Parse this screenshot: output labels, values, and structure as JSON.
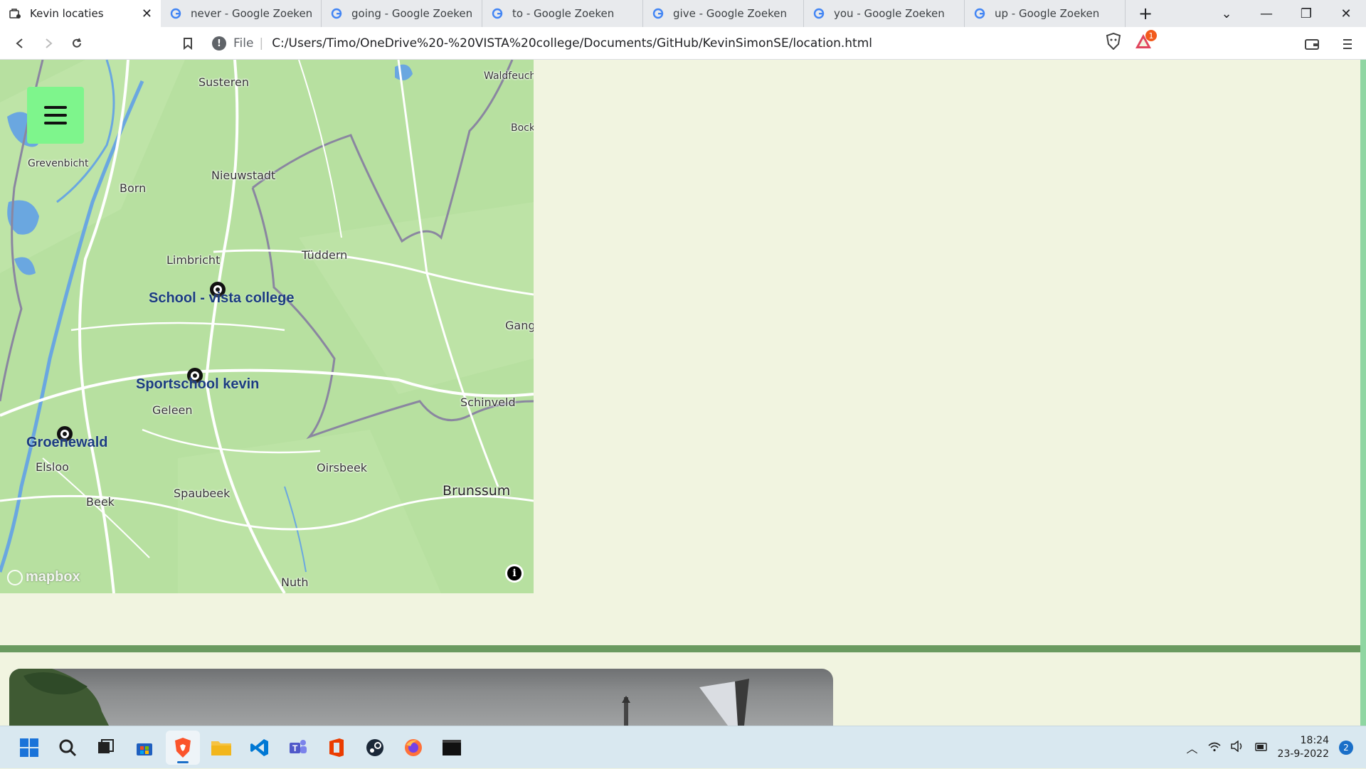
{
  "browser": {
    "tabs": [
      {
        "label": "Kevin locaties",
        "active": true
      },
      {
        "label": "never - Google Zoeken",
        "active": false
      },
      {
        "label": "going - Google Zoeken",
        "active": false
      },
      {
        "label": "to - Google Zoeken",
        "active": false
      },
      {
        "label": "give - Google Zoeken",
        "active": false
      },
      {
        "label": "you - Google Zoeken",
        "active": false
      },
      {
        "label": "up - Google Zoeken",
        "active": false
      }
    ],
    "address": {
      "scheme": "File",
      "url": "C:/Users/Timo/OneDrive%20-%20VISTA%20college/Documents/GitHub/KevinSimonSE/location.html"
    },
    "brave_badge_count": "1"
  },
  "map": {
    "places": [
      {
        "name": "Susteren"
      },
      {
        "name": "Waldfeucht"
      },
      {
        "name": "Bock"
      },
      {
        "name": "Grevenbicht"
      },
      {
        "name": "Born"
      },
      {
        "name": "Nieuwstadt"
      },
      {
        "name": "Limbricht"
      },
      {
        "name": "Tüddern"
      },
      {
        "name": "Gang"
      },
      {
        "name": "Geleen"
      },
      {
        "name": "Schinveld"
      },
      {
        "name": "Elsloo"
      },
      {
        "name": "Oirsbeek"
      },
      {
        "name": "Brunssum"
      },
      {
        "name": "Beek"
      },
      {
        "name": "Spaubeek"
      },
      {
        "name": "Nuth"
      }
    ],
    "markers": [
      {
        "label": "School - vista college"
      },
      {
        "label": "Sportschool kevin"
      },
      {
        "label": "Groenewald"
      }
    ],
    "logo": "mapbox",
    "attribution_symbol": "i"
  },
  "menu": {
    "icon": "hamburger-icon"
  },
  "taskbar": {
    "apps": [
      "start-icon",
      "search-icon",
      "task-view-icon",
      "store-icon",
      "brave-icon",
      "file-explorer-icon",
      "vscode-icon",
      "teams-icon",
      "office-icon",
      "steam-icon",
      "firefox-icon",
      "terminal-icon"
    ],
    "time": "18:24",
    "date": "23-9-2022",
    "notifications": "2"
  },
  "colors": {
    "page_bg": "#f1f4e0",
    "menu_button": "#7ef58c",
    "divider": "#6a9a60",
    "marker_label": "#1b3c80",
    "map_land": "#b7e0a0"
  }
}
